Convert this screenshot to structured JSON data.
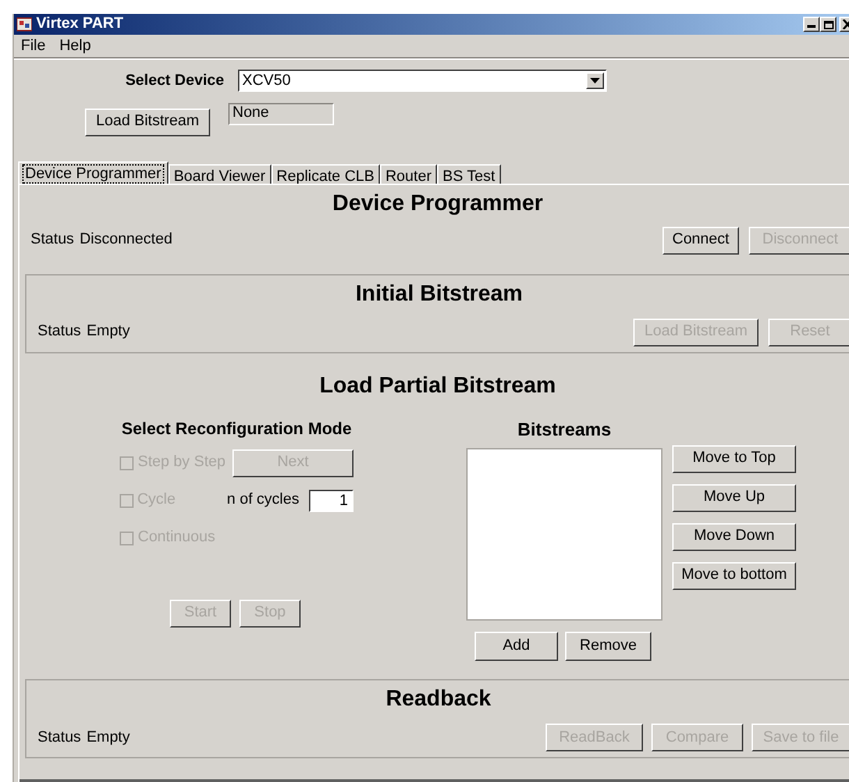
{
  "window": {
    "title": "Virtex PART"
  },
  "menu": [
    "File",
    "Help"
  ],
  "device": {
    "label": "Select Device",
    "value": "XCV50"
  },
  "load_bitstream": {
    "button": "Load Bitstream",
    "disabled": false,
    "file": "None"
  },
  "tabs": [
    {
      "label": "Device Programmer",
      "selected": true
    },
    {
      "label": "Board Viewer",
      "selected": false
    },
    {
      "label": "Replicate CLB",
      "selected": false
    },
    {
      "label": "Router",
      "selected": false
    },
    {
      "label": "BS Test",
      "selected": false
    }
  ],
  "device_programmer": {
    "title": "Device Programmer",
    "status_label": "Status",
    "status": "Disconnected",
    "buttons": [
      {
        "label": "Connect",
        "disabled": false
      },
      {
        "label": "Disconnect",
        "disabled": true
      }
    ]
  },
  "initial_bitstream": {
    "title": "Initial Bitstream",
    "status_label": "Status",
    "status": "Empty",
    "buttons": [
      {
        "label": "Load Bitstream",
        "disabled": true
      },
      {
        "label": "Reset",
        "disabled": true
      }
    ]
  },
  "partial": {
    "title": "Load Partial Bitstream",
    "mode_title": "Select Reconfiguration Mode",
    "modes": [
      {
        "label": "Step by Step",
        "checked": false,
        "disabled": true
      },
      {
        "label": "Cycle",
        "checked": false,
        "disabled": true
      },
      {
        "label": "Continuous",
        "checked": false,
        "disabled": true
      }
    ],
    "next": {
      "label": "Next",
      "disabled": true
    },
    "cycles": {
      "label": "n of cycles",
      "value": "1"
    },
    "run_buttons": [
      {
        "label": "Start",
        "disabled": true
      },
      {
        "label": "Stop",
        "disabled": true
      }
    ],
    "bitstreams_title": "Bitstreams",
    "move_buttons": [
      {
        "label": "Move to Top",
        "disabled": false
      },
      {
        "label": "Move Up",
        "disabled": false
      },
      {
        "label": "Move Down",
        "disabled": false
      },
      {
        "label": "Move to bottom",
        "disabled": false
      }
    ],
    "list_buttons": [
      {
        "label": "Add",
        "disabled": false
      },
      {
        "label": "Remove",
        "disabled": false
      }
    ]
  },
  "readback": {
    "title": "Readback",
    "status_label": "Status",
    "status": "Empty",
    "buttons": [
      {
        "label": "ReadBack",
        "disabled": true
      },
      {
        "label": "Compare",
        "disabled": true
      },
      {
        "label": "Save to file",
        "disabled": true
      }
    ]
  }
}
